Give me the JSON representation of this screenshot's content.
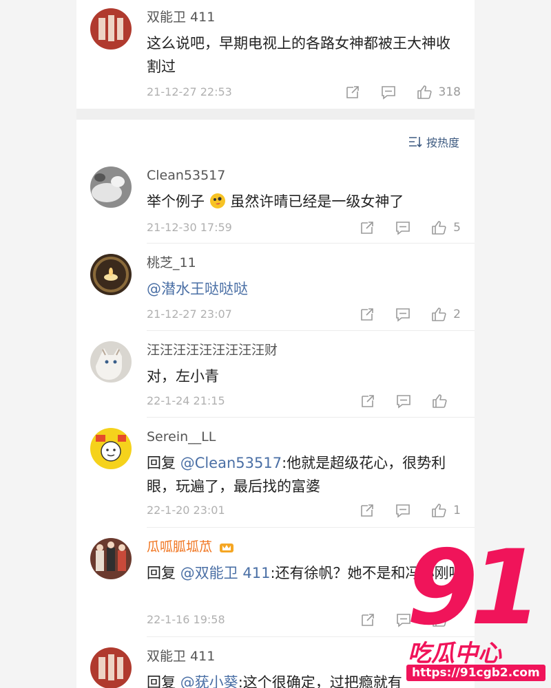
{
  "top_comment": {
    "username": "双能卫 411",
    "text": "这么说吧，早期电视上的各路女神都被王大神收割过",
    "time": "21-12-27 22:53",
    "likes": "318"
  },
  "sort": {
    "label": "按热度"
  },
  "comments": [
    {
      "username": "Clean53517",
      "text_a": "举个例子",
      "text_b": "虽然许晴已经是一级女神了",
      "time": "21-12-30 17:59",
      "likes": "5"
    },
    {
      "username": "桃芝_11",
      "mention": "@潜水王哒哒哒",
      "time": "21-12-27 23:07",
      "likes": "2"
    },
    {
      "username": "汪汪汪汪汪汪汪汪汪财",
      "text": "对，左小青",
      "time": "22-1-24 21:15",
      "likes": ""
    },
    {
      "username": "Serein__LL",
      "reply_prefix": "回复 ",
      "mention": "@Clean53517",
      "text": ":他就是超级花心，很势利眼，玩遍了，最后找的富婆",
      "time": "22-1-20 23:01",
      "likes": "1"
    },
    {
      "username": "瓜呱胍坬苽",
      "reply_prefix": "回复 ",
      "mention": "@双能卫 411",
      "text": ":还有徐帆？她不是和冯小刚吗",
      "time": "22-1-16 19:58",
      "likes": ""
    },
    {
      "username": "双能卫 411",
      "reply_prefix": "回复 ",
      "mention": "@莸小葵",
      "text": ":这个很确定，过把瘾就有",
      "time": "",
      "likes": ""
    }
  ],
  "watermark": {
    "number": "91",
    "title": "吃瓜中心",
    "url": "https://91cgb2.com"
  },
  "colors": {
    "accent_link": "#4a6fa5",
    "vip_orange": "#f0741f",
    "watermark": "#f0145a"
  }
}
